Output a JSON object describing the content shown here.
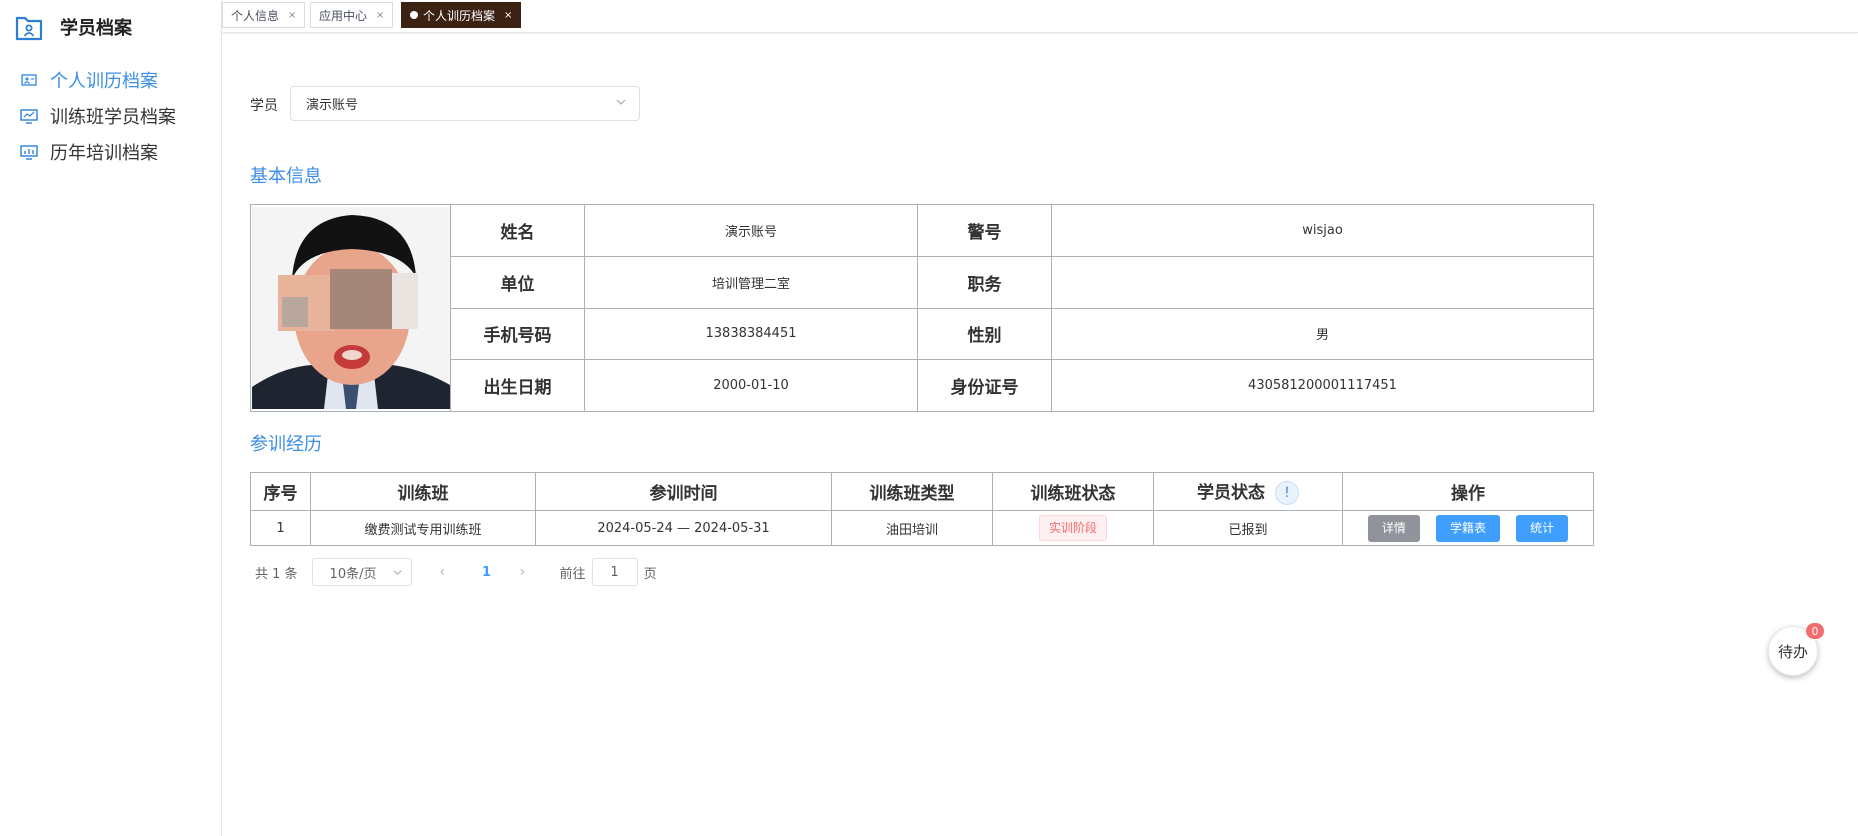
{
  "sidebar": {
    "title": "学员档案",
    "items": [
      {
        "label": "个人训历档案",
        "active": true
      },
      {
        "label": "训练班学员档案",
        "active": false
      },
      {
        "label": "历年培训档案",
        "active": false
      }
    ]
  },
  "tabs": [
    {
      "label": "个人信息",
      "active": false
    },
    {
      "label": "应用中心",
      "active": false
    },
    {
      "label": "个人训历档案",
      "active": true
    }
  ],
  "tab_close_glyph": "×",
  "student_filter": {
    "label": "学员",
    "value": "演示账号"
  },
  "basic_info": {
    "title": "基本信息",
    "rows": [
      {
        "k1": "姓名",
        "v1": "演示账号",
        "k2": "警号",
        "v2": "wisjao"
      },
      {
        "k1": "单位",
        "v1": "培训管理二室",
        "k2": "职务",
        "v2": ""
      },
      {
        "k1": "手机号码",
        "v1": "13838384451",
        "k2": "性别",
        "v2": "男"
      },
      {
        "k1": "出生日期",
        "v1": "2000-01-10",
        "k2": "身份证号",
        "v2": "430581200001117451"
      }
    ]
  },
  "training": {
    "title": "参训经历",
    "headers": [
      "序号",
      "训练班",
      "参训时间",
      "训练班类型",
      "训练班状态",
      "学员状态",
      "操作"
    ],
    "info_glyph": "!",
    "rows": [
      {
        "index": "1",
        "class_name": "缴费测试专用训练班",
        "period": "2024-05-24 — 2024-05-31",
        "type": "油田培训",
        "class_status": "实训阶段",
        "student_status": "已报到",
        "actions": [
          "详情",
          "学籍表",
          "统计"
        ]
      }
    ]
  },
  "pagination": {
    "total": "共 1 条",
    "page_size": "10条/页",
    "prev": "‹",
    "current": "1",
    "next": "›",
    "goto_label": "前往",
    "goto_value": "1",
    "goto_suffix": "页"
  },
  "todo": {
    "label": "待办",
    "count": "0"
  },
  "colors": {
    "accent": "#3a8ee6",
    "active_tab": "#3b2213",
    "button_blue": "#409eff",
    "button_gray": "#909399",
    "danger": "#f56c6c"
  }
}
